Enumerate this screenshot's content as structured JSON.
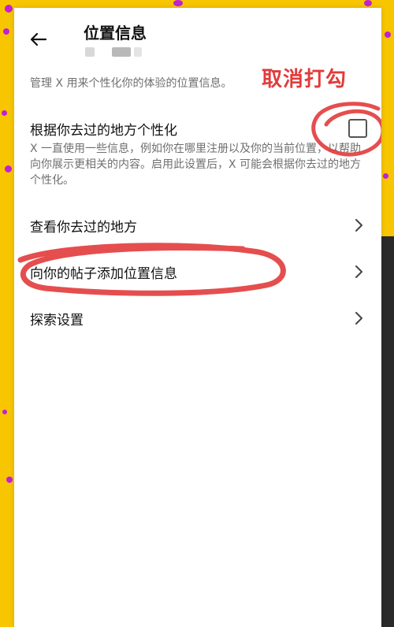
{
  "header": {
    "title": "位置信息"
  },
  "intro_text": "管理 X 用来个性化你的体验的位置信息。",
  "annotation": "取消打勾",
  "personalize": {
    "title": "根据你去过的地方个性化",
    "description": "X 一直使用一些信息，例如你在哪里注册以及你的当前位置，以帮助向你展示更相关的内容。启用此设置后，X 可能会根据你去过的地方个性化。",
    "checked": false
  },
  "menu_items": [
    {
      "label": "查看你去过的地方"
    },
    {
      "label": "向你的帖子添加位置信息"
    },
    {
      "label": "探索设置"
    }
  ],
  "colors": {
    "background": "#f7c600",
    "panel": "#ffffff",
    "annotation": "#e23b3b",
    "dots": "#c21fd6"
  },
  "icons": [
    "arrow-left-icon",
    "checkbox-icon",
    "chevron-right-icon"
  ]
}
